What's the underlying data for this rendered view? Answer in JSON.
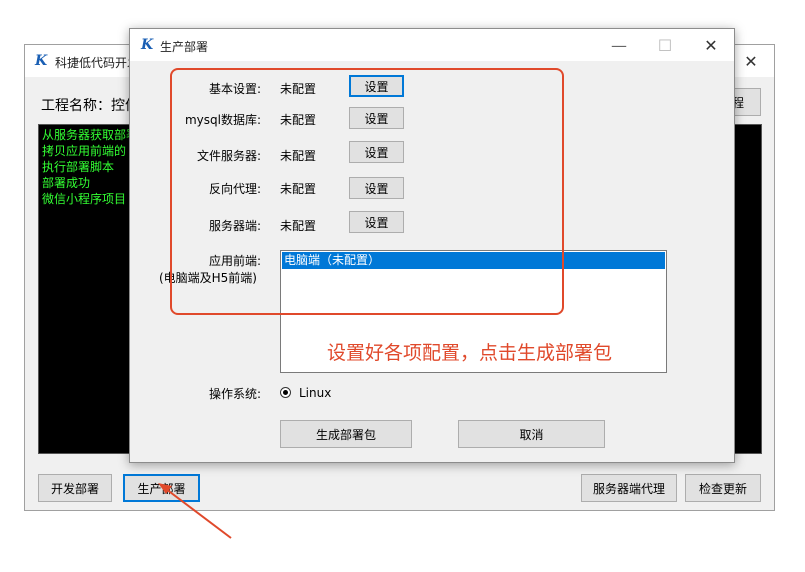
{
  "main_window": {
    "logo": "K",
    "title": "科捷低代码开发",
    "close_glyph": "✕",
    "project_label": "工程名称：控件",
    "project_btn_label": "程",
    "console_lines": [
      "从服务器获取部署",
      "拷贝应用前端的",
      "执行部署脚本",
      "部署成功",
      "微信小程序项目"
    ],
    "buttons": {
      "dev_deploy": "开发部署",
      "prod_deploy": "生产部署",
      "server_proxy": "服务器端代理",
      "check_update": "检查更新"
    }
  },
  "dialog": {
    "logo": "K",
    "title": "生产部署",
    "controls": {
      "minimize": "—",
      "maximize": "☐",
      "close": "✕"
    },
    "rows": [
      {
        "label": "基本设置:",
        "status": "未配置",
        "button": "设置"
      },
      {
        "label": "mysql数据库:",
        "status": "未配置",
        "button": "设置"
      },
      {
        "label": "文件服务器:",
        "status": "未配置",
        "button": "设置"
      },
      {
        "label": "反向代理:",
        "status": "未配置",
        "button": "设置"
      },
      {
        "label": "服务器端:",
        "status": "未配置",
        "button": "设置"
      }
    ],
    "frontend_label_1": "应用前端:",
    "frontend_label_2": "(电脑端及H5前端)",
    "frontend_items": [
      "电脑端（未配置）"
    ],
    "os_label": "操作系统:",
    "os_option": "Linux",
    "generate_button": "生成部署包",
    "cancel_button": "取消"
  },
  "annotation": {
    "text": "设置好各项配置，点击生成部署包",
    "color": "#e0492b"
  },
  "colors": {
    "accent": "#0078d7",
    "console_text": "#33ff33",
    "selection": "#0078d7"
  }
}
